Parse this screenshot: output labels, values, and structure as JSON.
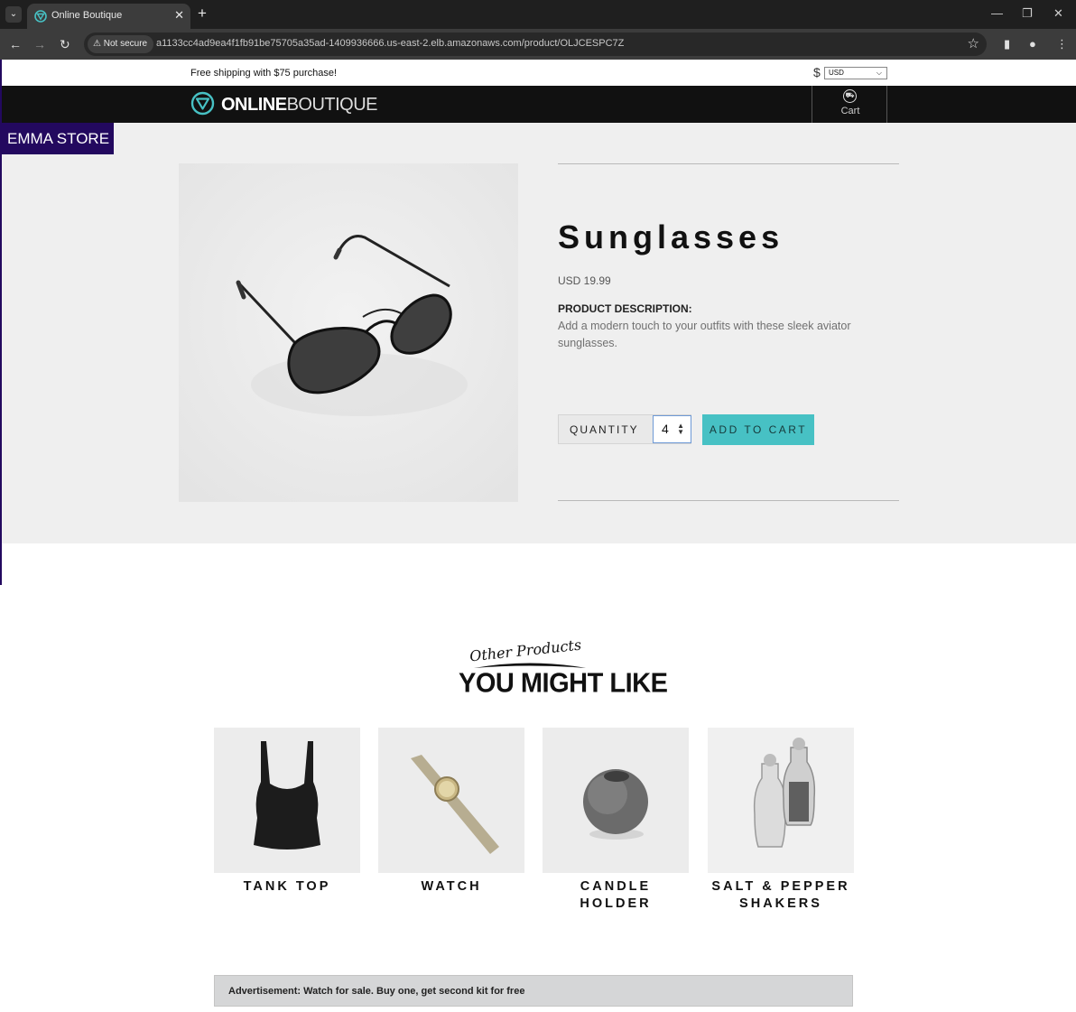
{
  "browser": {
    "tab_title": "Online Boutique",
    "security_label": "Not secure",
    "url": "a1133cc4ad9ea4f1fb91be75705a35ad-1409936666.us-east-2.elb.amazonaws.com/product/OLJCESPC7Z"
  },
  "header": {
    "shipping_message": "Free shipping with $75 purchase!",
    "currency_symbol": "$",
    "currency_selected": "USD",
    "logo_bold": "ONLINE",
    "logo_light": "BOUTIQUE",
    "cart_label": "Cart",
    "store_badge": "EMMA STORE"
  },
  "product": {
    "name": "Sunglasses",
    "price": "USD 19.99",
    "description_label": "PRODUCT DESCRIPTION:",
    "description": "Add a modern touch to your outfits with these sleek aviator sunglasses.",
    "quantity_label": "QUANTITY",
    "quantity_value": "4",
    "add_to_cart_label": "ADD TO CART"
  },
  "recommendations": {
    "heading_script": "Other Products",
    "heading_main": "YOU MIGHT LIKE",
    "items": [
      {
        "name": "TANK TOP"
      },
      {
        "name": "WATCH"
      },
      {
        "name": "CANDLE HOLDER"
      },
      {
        "name": "SALT & PEPPER SHAKERS"
      }
    ]
  },
  "ad": {
    "text": "Advertisement: Watch for sale. Buy one, get second kit for free"
  },
  "colors": {
    "accent": "#47c1c4",
    "badge": "#23095f",
    "navbar": "#111111",
    "hero_bg": "#efefef"
  }
}
